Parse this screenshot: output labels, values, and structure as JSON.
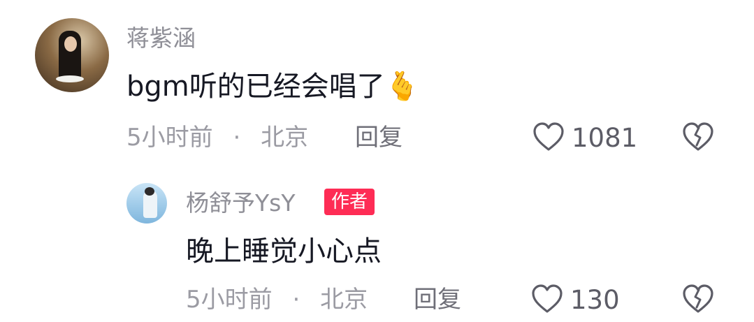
{
  "comments": [
    {
      "username": "蒋紫涵",
      "text": "bgm听的已经会唱了",
      "emoji": "🫰",
      "time": "5小时前",
      "separator": "·",
      "location": "北京",
      "reply_label": "回复",
      "likes": "1081"
    }
  ],
  "reply": {
    "username": "杨舒予YsY",
    "badge": "作者",
    "text": "晚上睡觉小心点",
    "time": "5小时前",
    "separator": "·",
    "location": "北京",
    "reply_label": "回复",
    "likes": "130"
  },
  "colors": {
    "badge": "#fe2c55",
    "username": "#8f8f97",
    "text": "#161823"
  }
}
